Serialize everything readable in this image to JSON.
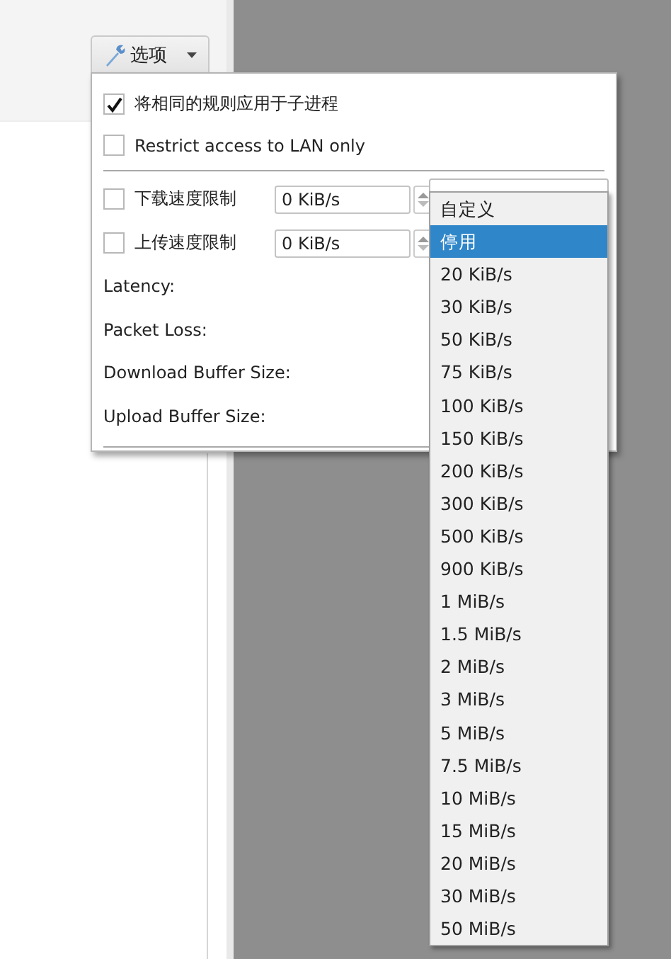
{
  "options_button": {
    "label": "选项"
  },
  "options_panel": {
    "checkboxes": [
      {
        "label": "将相同的规则应用于子进程",
        "checked": true
      },
      {
        "label": "Restrict access to LAN only",
        "checked": false
      }
    ],
    "limits": [
      {
        "label": "下载速度限制",
        "checked": false,
        "value": "0 KiB/s"
      },
      {
        "label": "上传速度限制",
        "checked": false,
        "value": "0 KiB/s"
      }
    ],
    "fields": [
      "Latency:",
      "Packet Loss:",
      "Download Buffer Size:",
      "Upload Buffer Size:"
    ]
  },
  "dropdown": {
    "items": [
      {
        "label": "自定义",
        "selected": false
      },
      {
        "label": "停用",
        "selected": true
      },
      {
        "label": "20 KiB/s",
        "selected": false
      },
      {
        "label": "30 KiB/s",
        "selected": false
      },
      {
        "label": "50 KiB/s",
        "selected": false
      },
      {
        "label": "75 KiB/s",
        "selected": false
      },
      {
        "label": "100 KiB/s",
        "selected": false
      },
      {
        "label": "150 KiB/s",
        "selected": false
      },
      {
        "label": "200 KiB/s",
        "selected": false
      },
      {
        "label": "300 KiB/s",
        "selected": false
      },
      {
        "label": "500 KiB/s",
        "selected": false
      },
      {
        "label": "900 KiB/s",
        "selected": false
      },
      {
        "label": "1 MiB/s",
        "selected": false
      },
      {
        "label": "1.5 MiB/s",
        "selected": false
      },
      {
        "label": "2 MiB/s",
        "selected": false
      },
      {
        "label": "3 MiB/s",
        "selected": false
      },
      {
        "label": "5 MiB/s",
        "selected": false
      },
      {
        "label": "7.5 MiB/s",
        "selected": false
      },
      {
        "label": "10 MiB/s",
        "selected": false
      },
      {
        "label": "15 MiB/s",
        "selected": false
      },
      {
        "label": "20 MiB/s",
        "selected": false
      },
      {
        "label": "30 MiB/s",
        "selected": false
      },
      {
        "label": "50 MiB/s",
        "selected": false
      }
    ]
  }
}
